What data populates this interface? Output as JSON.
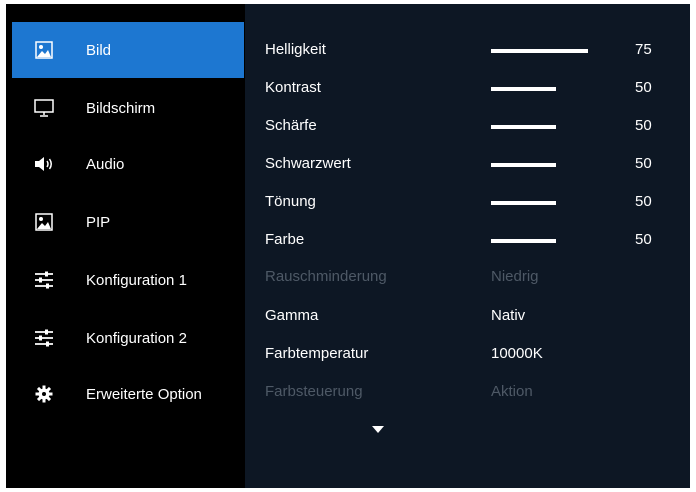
{
  "sidebar": {
    "items": [
      {
        "label": "Bild",
        "icon": "picture-icon",
        "active": true
      },
      {
        "label": "Bildschirm",
        "icon": "monitor-icon",
        "active": false
      },
      {
        "label": "Audio",
        "icon": "speaker-icon",
        "active": false
      },
      {
        "label": "PIP",
        "icon": "picture-icon",
        "active": false
      },
      {
        "label": "Konfiguration 1",
        "icon": "sliders-icon",
        "active": false
      },
      {
        "label": "Konfiguration 2",
        "icon": "sliders-icon",
        "active": false
      },
      {
        "label": "Erweiterte Option",
        "icon": "gear-icon",
        "active": false
      }
    ]
  },
  "settings": {
    "rows": [
      {
        "label": "Helligkeit",
        "value": "75",
        "level": 75
      },
      {
        "label": "Kontrast",
        "value": "50",
        "level": 50
      },
      {
        "label": "Schärfe",
        "value": "50",
        "level": 50
      },
      {
        "label": "Schwarzwert",
        "value": "50",
        "level": 50
      },
      {
        "label": "Tönung",
        "value": "50",
        "level": 50
      },
      {
        "label": "Farbe",
        "value": "50",
        "level": 50
      },
      {
        "label": "Rauschminderung",
        "value": "Niedrig",
        "disabled": true
      },
      {
        "label": "Gamma",
        "value": "Nativ"
      },
      {
        "label": "Farbtemperatur",
        "value": "10000K"
      },
      {
        "label": "Farbsteuerung",
        "value": "Aktion",
        "disabled": true
      }
    ]
  },
  "colors": {
    "active": "#1d77d1",
    "panel": "#0d1724",
    "sidebar": "#000000",
    "disabled_text": "#4e5966",
    "text": "#ffffff"
  }
}
